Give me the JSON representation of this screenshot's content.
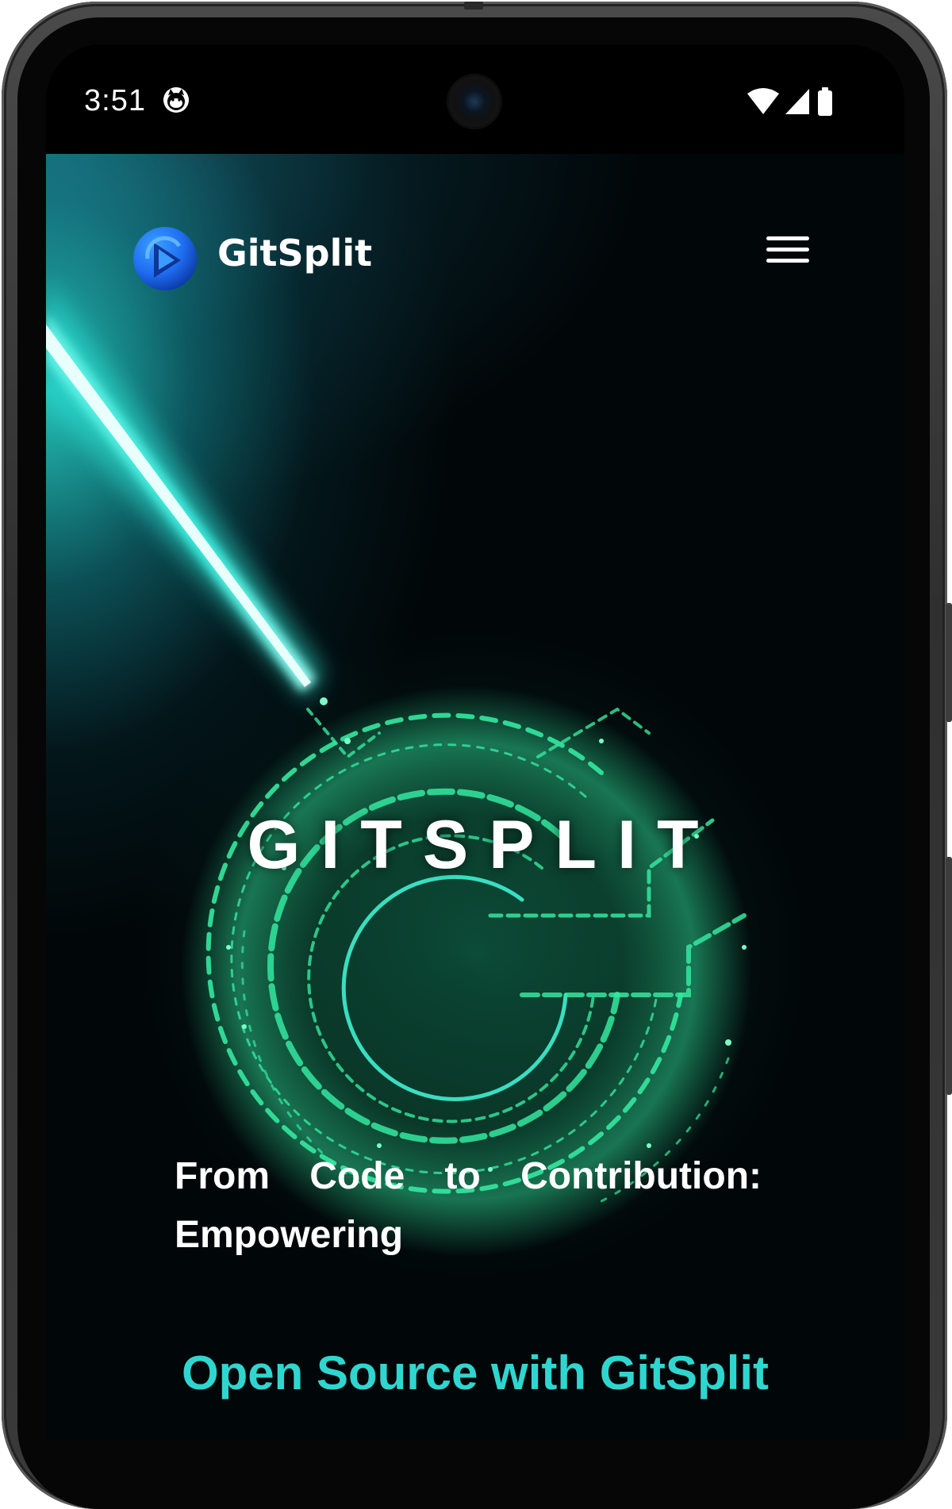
{
  "status_bar": {
    "time": "3:51",
    "icons": [
      "cat-notification-icon",
      "wifi-icon",
      "cellular-signal-icon",
      "battery-icon"
    ]
  },
  "nav": {
    "brand": "GitSplit",
    "logo_icon": "gitsplit-logo-icon",
    "menu_icon": "hamburger-menu-icon"
  },
  "hero": {
    "title": "GITSPLIT",
    "subtitle_line1": "From Code to Contribution:",
    "subtitle_line2": "Empowering",
    "accent_line": "Open Source with GitSplit"
  },
  "colors": {
    "accent": "#2fd6cf",
    "glow_green": "#2ee89a",
    "beam": "#3af0e0",
    "logo_blue": "#1f6cf0",
    "background": "#010608"
  }
}
